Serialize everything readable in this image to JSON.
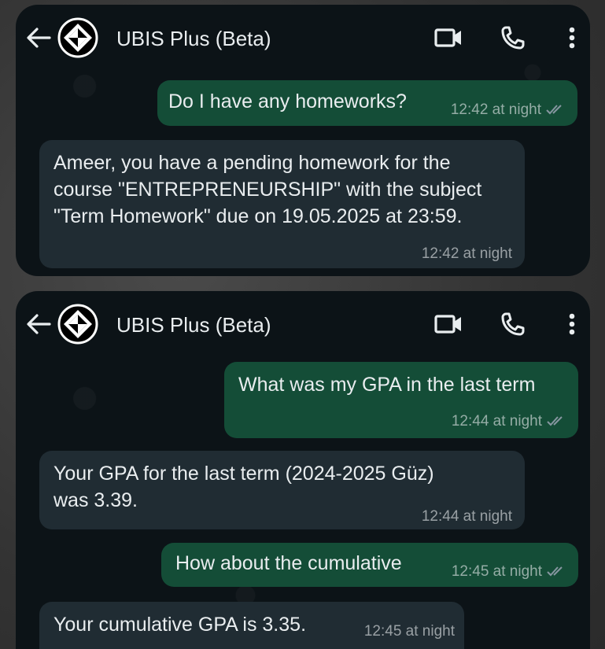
{
  "chat": {
    "name": "UBIS Plus (Beta)",
    "colors": {
      "outgoing": "#144d37",
      "incoming": "#202c33",
      "background": "#0c1317",
      "read_tick": "#8696a0"
    }
  },
  "screens": [
    {
      "messages": [
        {
          "dir": "out",
          "text": "Do I have any homeworks?",
          "time": "12:42 at night",
          "status": "read"
        },
        {
          "dir": "in",
          "text": "Ameer, you have a pending homework for the\ncourse \"ENTREPRENEURSHIP\" with the subject\n\"Term Homework\" due on 19.05.2025 at 23:59.",
          "time": "12:42 at night"
        }
      ]
    },
    {
      "messages": [
        {
          "dir": "out",
          "text": "What was my GPA in the last term",
          "time": "12:44 at night",
          "status": "read"
        },
        {
          "dir": "in",
          "text": "Your GPA for the last term (2024-2025 Güz)\nwas 3.39.",
          "time": "12:44 at night"
        },
        {
          "dir": "out",
          "text": "How about the cumulative",
          "time": "12:45 at night",
          "status": "read"
        },
        {
          "dir": "in",
          "text": "Your cumulative GPA is 3.35.",
          "time": "12:45 at night"
        }
      ]
    }
  ]
}
